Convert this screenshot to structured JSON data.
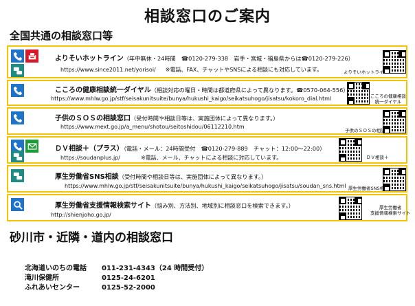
{
  "title": "相談窓口のご案内",
  "national_heading": "全国共通の相談窓口等",
  "local_heading": "砂川市・近隣・道内の相談窓口",
  "colors": {
    "border": "#f2c400",
    "phone_blue": "#1f73c8",
    "chat_teal": "#1e8c84",
    "fax_red": "#d7192c",
    "mail_green": "#1f9c3a"
  },
  "entries": [
    {
      "name": "よりそいホットライン",
      "info": "（年中無休・24時間　☎0120-279-338　岩手・宮城・福島県からは☎0120-279-226）",
      "url": "https://www.since2011.net/yorisoi/",
      "note": "※電話、FAX、チャットやSNSによる相談にも対応しています。",
      "qr_label": "よりそいホットライン",
      "icons": [
        "phone-icon",
        "fax-icon",
        "chat-icon"
      ]
    },
    {
      "name": "こころの健康相談統一ダイヤル",
      "info": "（相談対応の曜日・時間は都道府県によって異なります。☎0570-064-556）",
      "url": "https://www.mhlw.go.jp/stf/seisakunitsuite/bunya/hukushi_kaigo/seikatsuhogo/jisatsu/kokoro_dial.html",
      "qr_label": "こころの健康相談\n統一ダイヤル",
      "icons": [
        "phone-icon"
      ]
    },
    {
      "name": "子供のＳＯＳの相談窓口",
      "info": "（受付時間や相談日等は、実施団体によって異なります。）",
      "url": "https://www.mext.go.jp/a_menu/shotou/seitoshidou/06112210.htm",
      "qr_label": "子供のＳＯＳの相談窓口",
      "icons": [
        "phone-icon"
      ]
    },
    {
      "name": "ＤＶ相談＋（プラス）",
      "info": "（電話・メール：24時間受付　☎0120-279-889　チャット：12:00～22:00）",
      "url": "https://soudanplus.jp/",
      "note": "※電話、メール、チャットによる相談に対応しています。",
      "qr_label": "ＤＶ相談＋",
      "icons": [
        "phone-icon",
        "mail-icon",
        "chat-icon"
      ]
    },
    {
      "name": "厚生労働省SNS相談",
      "info": "（受付時間や相談日等は、実施団体によって異なります。）",
      "url": "https://www.mhlw.go.jp/stf/seisakunitsuite/bunya/hukushi_kaigo/seikatsuhogo/jisatsu/soudan_sns.html",
      "qr_label": "厚生労働省SNS相談",
      "icons": [
        "chat-icon"
      ]
    },
    {
      "name": "厚生労働省支援情報検索サイト",
      "info": "（悩み別、方法別、地域別に相談窓口を検索できます。）",
      "url": "http://shienjoho.go.jp/",
      "qr_label": "厚生労働省\n支援情報検索サイト",
      "icons": [
        "search-icon"
      ]
    }
  ],
  "local": [
    {
      "name": "北海道いのちの電話",
      "phone": "011-231-4343（24 時間受付）"
    },
    {
      "name": "滝川保健所",
      "phone": "0125-24-6201"
    },
    {
      "name": "ふれあいセンター",
      "phone": "0125-52-2000"
    }
  ]
}
